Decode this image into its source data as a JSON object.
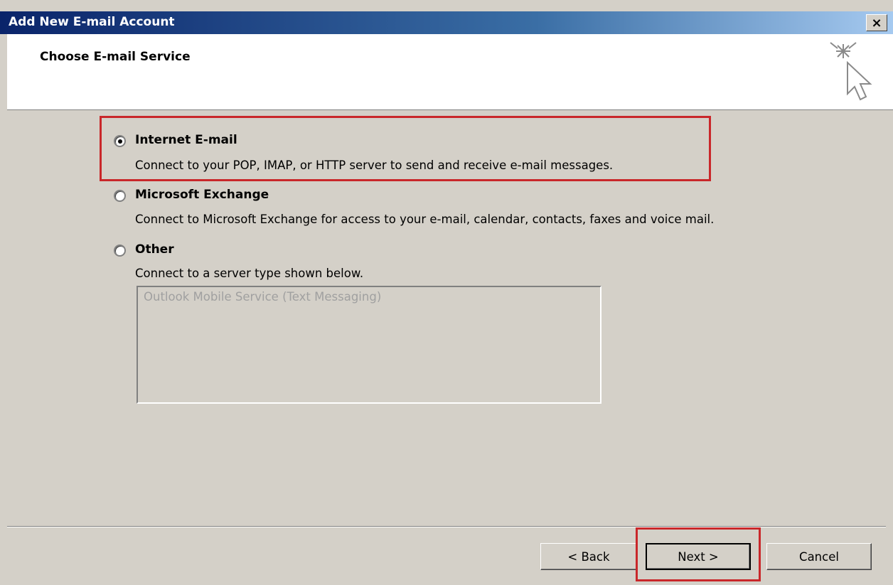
{
  "window": {
    "title": "Add New E-mail Account",
    "close_label": "×"
  },
  "header": {
    "title": "Choose E-mail Service",
    "icon": "sparkle-cursor-icon"
  },
  "options": [
    {
      "label": "Internet E-mail",
      "description": "Connect to your POP, IMAP, or HTTP server to send and receive e-mail messages.",
      "selected": true
    },
    {
      "label": "Microsoft Exchange",
      "description": "Connect to Microsoft Exchange for access to your e-mail, calendar, contacts, faxes and voice mail.",
      "selected": false
    },
    {
      "label": "Other",
      "description": "Connect to a server type shown below.",
      "selected": false
    }
  ],
  "server_list": {
    "items": [
      "Outlook Mobile Service (Text Messaging)"
    ]
  },
  "buttons": {
    "back": "< Back",
    "next": "Next >",
    "cancel": "Cancel"
  },
  "colors": {
    "highlight": "#c9272a",
    "dialog_bg": "#d4d0c8",
    "titlebar_start": "#0a246a"
  }
}
